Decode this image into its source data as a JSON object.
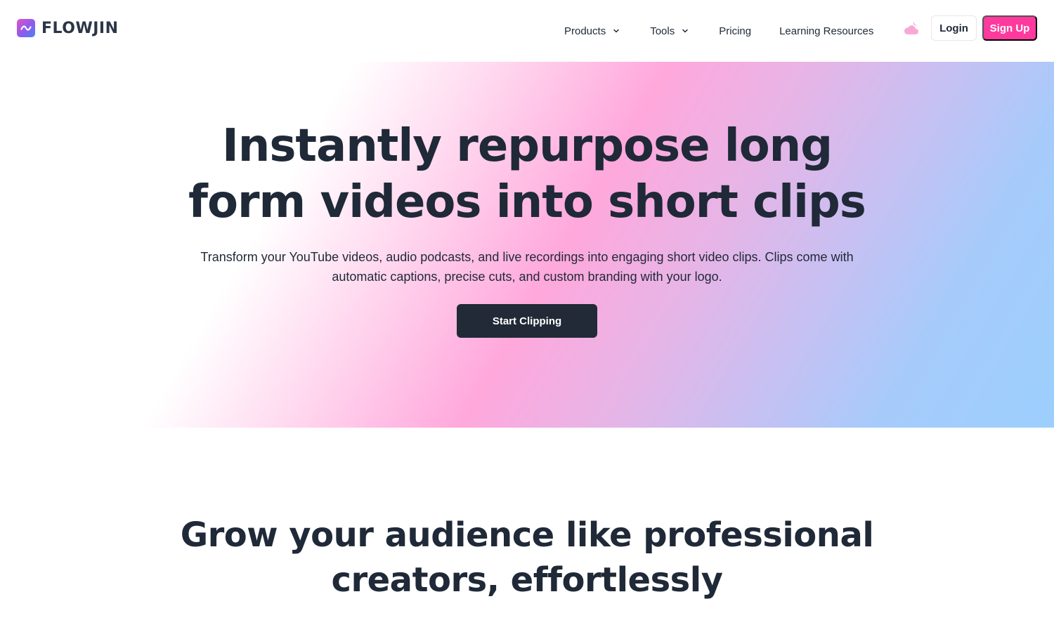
{
  "brand": {
    "name": "FLOWJIN",
    "logo_icon": "wave-icon"
  },
  "nav": {
    "items": [
      {
        "label": "Products",
        "has_dropdown": true
      },
      {
        "label": "Tools",
        "has_dropdown": true
      },
      {
        "label": "Pricing",
        "has_dropdown": false
      },
      {
        "label": "Learning Resources",
        "has_dropdown": false
      }
    ],
    "theme_toggle_icon": "cloud-moon-icon",
    "login_label": "Login",
    "signup_label": "Sign Up"
  },
  "hero": {
    "title_line1": "Instantly repurpose long",
    "title_line2": "form videos into short clips",
    "subtitle": "Transform your YouTube videos, audio podcasts, and live recordings into engaging short video clips. Clips come with automatic captions, precise cuts, and custom branding with your logo.",
    "cta_label": "Start Clipping"
  },
  "section": {
    "title_line1": "Grow your audience like professional",
    "title_line2": "creators, effortlessly"
  },
  "colors": {
    "accent": "#fe3a9e",
    "text_dark": "#1f2937",
    "cta_bg": "#212a36",
    "gradient_pink": "#ffa8dc",
    "gradient_blue": "#9ccffd"
  }
}
